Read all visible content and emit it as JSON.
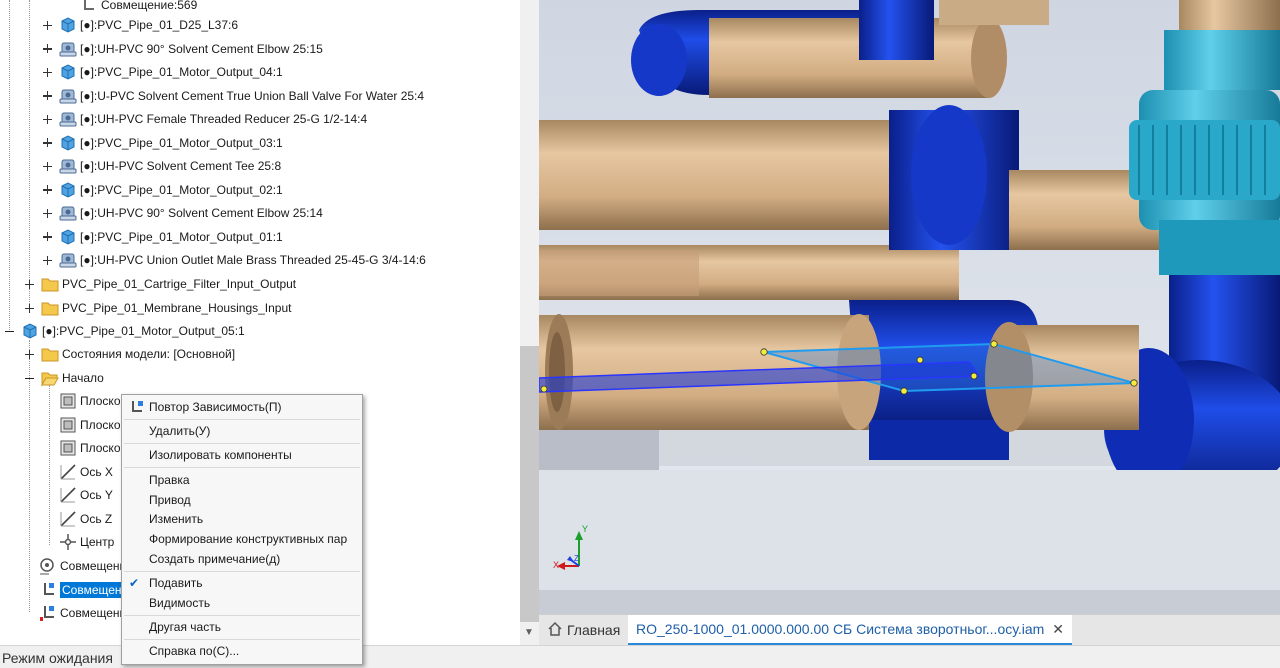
{
  "tree": {
    "top_partial": "Совмещение:569",
    "items": [
      {
        "label": "[●]:PVC_Pipe_01_D25_L37:6",
        "icon": "part-icon"
      },
      {
        "label": "[●]:UH-PVC 90° Solvent Cement Elbow 25:15",
        "icon": "content-center-part-icon"
      },
      {
        "label": "[●]:PVC_Pipe_01_Motor_Output_04:1",
        "icon": "part-icon"
      },
      {
        "label": "[●]:U-PVC Solvent Cement True Union Ball Valve For Water 25:4",
        "icon": "content-center-part-icon"
      },
      {
        "label": "[●]:UH-PVC Female Threaded Reducer 25-G 1/2-14:4",
        "icon": "content-center-part-icon"
      },
      {
        "label": "[●]:PVC_Pipe_01_Motor_Output_03:1",
        "icon": "part-icon"
      },
      {
        "label": "[●]:UH-PVC Solvent Cement Tee 25:8",
        "icon": "content-center-part-icon"
      },
      {
        "label": "[●]:PVC_Pipe_01_Motor_Output_02:1",
        "icon": "part-icon"
      },
      {
        "label": "[●]:UH-PVC 90° Solvent Cement Elbow 25:14",
        "icon": "content-center-part-icon"
      },
      {
        "label": "[●]:PVC_Pipe_01_Motor_Output_01:1",
        "icon": "part-icon"
      },
      {
        "label": "[●]:UH-PVC Union Outlet Male Brass Threaded 25-45-G 3/4-14:6",
        "icon": "content-center-part-icon"
      }
    ],
    "folders": [
      {
        "label": "PVC_Pipe_01_Cartrige_Filter_Input_Output"
      },
      {
        "label": "PVC_Pipe_01_Membrane_Housings_Input"
      }
    ],
    "root_part": "[●]:PVC_Pipe_01_Motor_Output_05:1",
    "model_states": "Состояния модели: [Основной]",
    "origin": "Начало",
    "origin_children": [
      {
        "label": "Плоскость",
        "icon": "plane-icon"
      },
      {
        "label": "Плоскость",
        "icon": "plane-icon"
      },
      {
        "label": "Плоскость",
        "icon": "plane-icon"
      },
      {
        "label": "Ось X",
        "icon": "axis-icon"
      },
      {
        "label": "Ось Y",
        "icon": "axis-icon"
      },
      {
        "label": "Ось Z",
        "icon": "axis-icon"
      },
      {
        "label": "Центр",
        "icon": "point-icon"
      }
    ],
    "constraints": [
      {
        "label": "Совмещение",
        "selected": false
      },
      {
        "label": "Совмещение",
        "selected": true
      },
      {
        "label": "Совмещение",
        "selected": false
      }
    ]
  },
  "context_menu": {
    "items": [
      "Повтор Зависимость(П)",
      "Удалить(У)",
      "Изолировать компоненты",
      "Правка",
      "Привод",
      "Изменить",
      "Формирование конструктивных пар",
      "Создать примечание(д)",
      "Подавить",
      "Видимость",
      "Другая часть",
      "Справка по(С)..."
    ],
    "checked": "Подавить"
  },
  "viewport": {
    "triad": {
      "x": "X",
      "y": "Y",
      "z": "Z"
    }
  },
  "tabs": {
    "home": "Главная",
    "document": "RO_250-1000_01.0000.000.00 СБ Система зворотньог...осу.iam",
    "close_glyph": "✕"
  },
  "status": {
    "text": "Режим ожидания"
  },
  "colors": {
    "pipe_tan": "#d7b48c",
    "fitting_blue": "#0c2fc0",
    "union_cyan": "#2fb3d2",
    "selection_blue": "#0078d7"
  }
}
